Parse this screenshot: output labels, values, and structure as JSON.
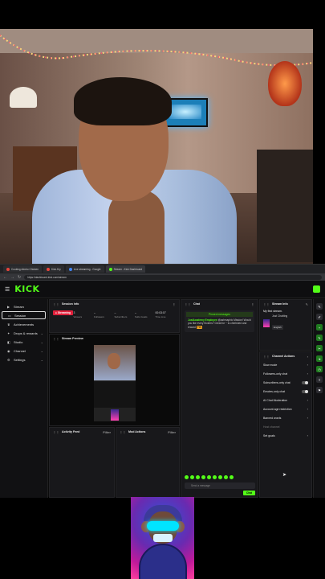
{
  "browser": {
    "tabs": [
      {
        "label": "Cooking Adobo Chicken",
        "color": "#e8453c"
      },
      {
        "label": "Kick.Kry",
        "color": "#e8453c"
      },
      {
        "label": "Live streaming - Google",
        "color": "#4285f4"
      },
      {
        "label": "Stream - Kick Dashboard",
        "color": "#53fc18"
      }
    ],
    "url": "https://dashboard.kick.com/stream"
  },
  "kick": {
    "logo": "KICK",
    "sidebar": [
      {
        "label": "Stream",
        "icon": "video-icon",
        "active": false,
        "chevron": false
      },
      {
        "label": "Session",
        "icon": "monitor-icon",
        "active": true,
        "chevron": false
      },
      {
        "label": "Achievements",
        "icon": "trophy-icon",
        "active": false,
        "chevron": false
      },
      {
        "label": "Drops & rewards",
        "icon": "gift-icon",
        "active": false,
        "chevron": true
      },
      {
        "label": "Studio",
        "icon": "studio-icon",
        "active": false,
        "chevron": true
      },
      {
        "label": "Channel",
        "icon": "channel-icon",
        "active": false,
        "chevron": true
      },
      {
        "label": "Settings",
        "icon": "gear-icon",
        "active": false,
        "chevron": true
      }
    ],
    "session": {
      "title": "Session Info",
      "live_label": "● Streaming",
      "stats": [
        {
          "value": "3",
          "label": "Viewers"
        },
        {
          "value": "–",
          "label": "Followers"
        },
        {
          "value": "–",
          "label": "Subscribers"
        },
        {
          "value": "–",
          "label": "Subs Goals"
        },
        {
          "value": "00:03:07",
          "label": "Time Live"
        }
      ]
    },
    "preview_title": "Stream Preview",
    "activity": {
      "title": "Activity Feed",
      "filter": "Filter"
    },
    "mod": {
      "title": "Mod Actions",
      "filter": "Filter"
    },
    "chat": {
      "title": "Chat",
      "pinned_title": "Pinned messages",
      "pinned_user": "JustAcademy Employee",
      "pinned_text": "@ashmaphic Mission! Would you like every Kickers? Great for ~ to cherished and reward",
      "pinned_tag": "PIN",
      "input_placeholder": "Send a message",
      "send_label": "Chat"
    },
    "stream_info": {
      "title": "Stream Info",
      "stream_title": "My first stream.",
      "category": "Just Chatting",
      "language": "English"
    },
    "channel_actions": {
      "title": "Channel Actions",
      "items": [
        {
          "label": "Slow mode",
          "control": "chevron",
          "dim": false
        },
        {
          "label": "Followers-only chat",
          "control": "chevron",
          "dim": false
        },
        {
          "label": "Subscribers-only chat",
          "control": "toggle",
          "dim": false
        },
        {
          "label": "Emotes-only chat",
          "control": "toggle",
          "dim": false
        },
        {
          "label": "AI Chat Moderation",
          "control": "chevron",
          "dim": false
        },
        {
          "label": "Account age restriction",
          "control": "chevron",
          "dim": false
        },
        {
          "label": "Banned words",
          "control": "chevron",
          "dim": false
        },
        {
          "label": "Host channel",
          "control": "none",
          "dim": true
        },
        {
          "label": "Set goals",
          "control": "chevron",
          "dim": false
        }
      ]
    },
    "rail": [
      {
        "icon": "edit-icon",
        "color": "#2b2b30"
      },
      {
        "icon": "pencil-icon",
        "color": "#2b2b30"
      },
      {
        "icon": "plus-icon",
        "color": "#1f7a1f"
      },
      {
        "icon": "edit-icon",
        "color": "#1f7a1f"
      },
      {
        "icon": "clip-icon",
        "color": "#1f7a1f"
      },
      {
        "icon": "raid-icon",
        "color": "#1f7a1f"
      },
      {
        "icon": "clock-icon",
        "color": "#1f7a1f"
      },
      {
        "icon": "share-icon",
        "color": "#2b2b30"
      },
      {
        "icon": "flag-icon",
        "color": "#2b2b30"
      }
    ]
  }
}
